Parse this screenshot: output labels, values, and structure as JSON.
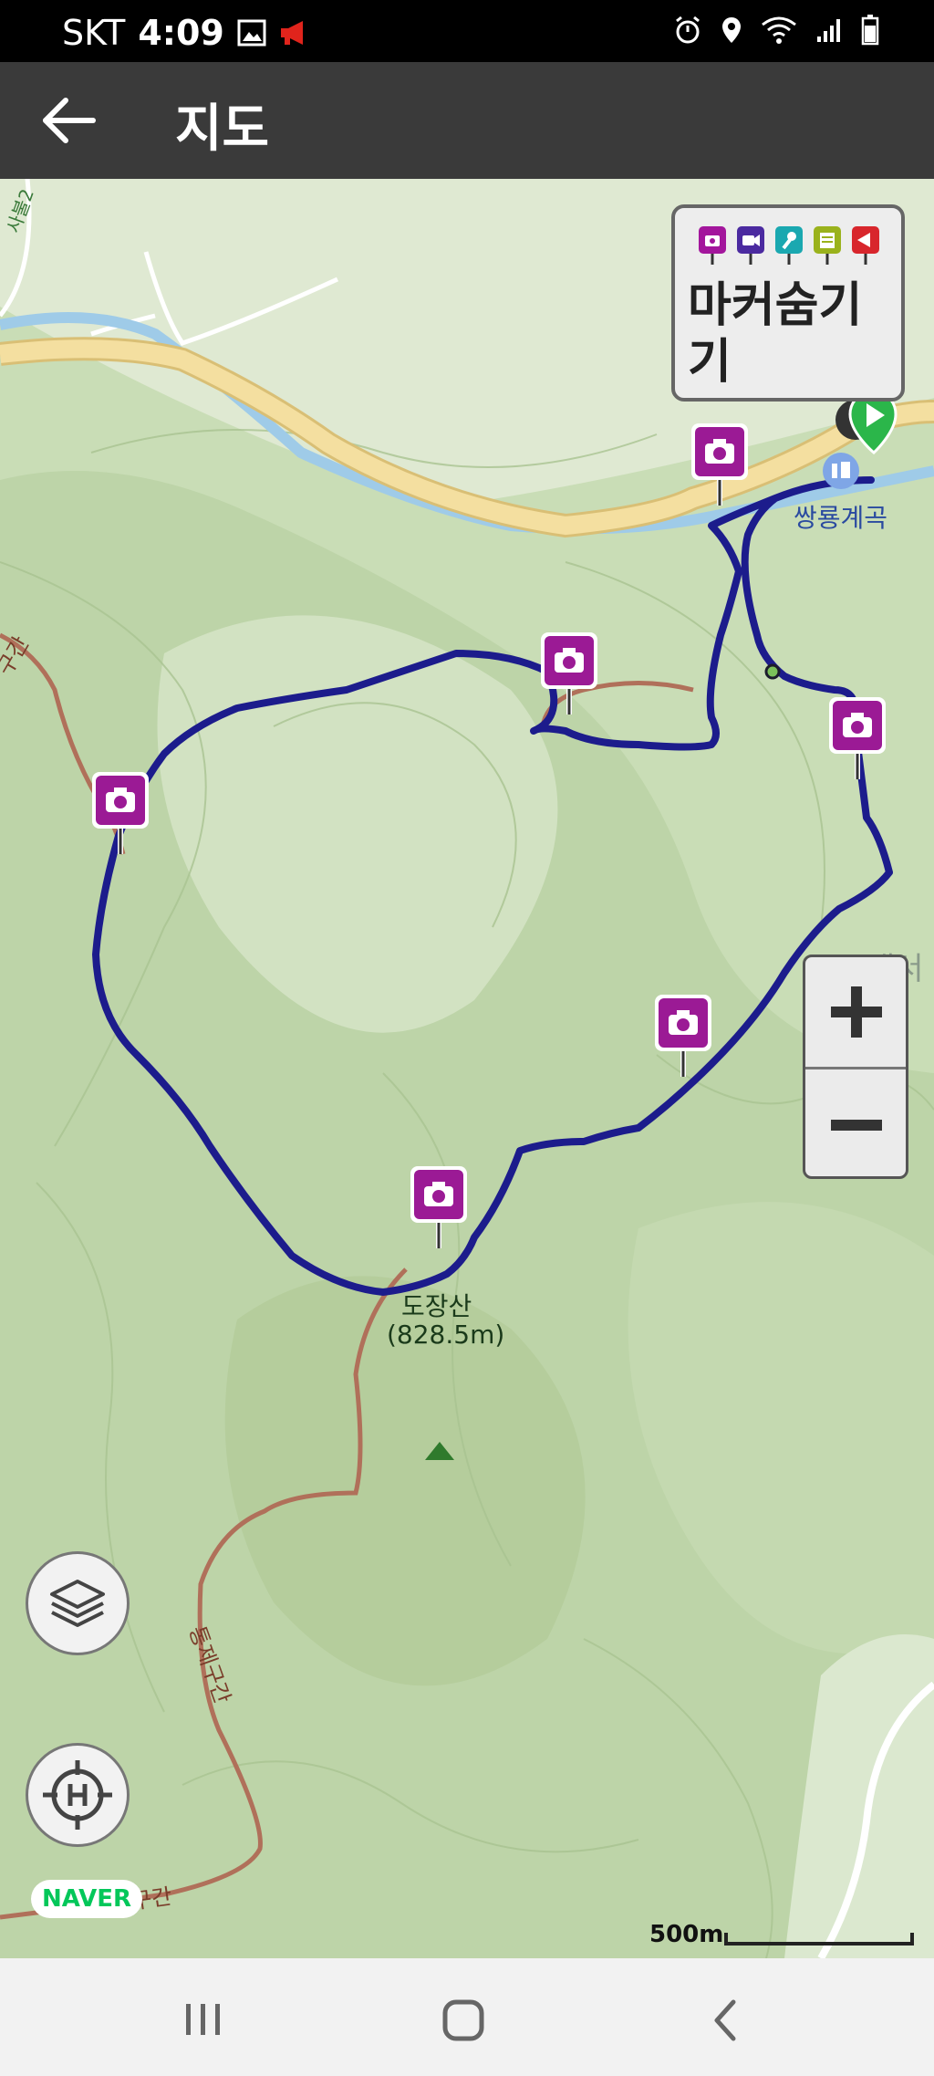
{
  "status_bar": {
    "carrier": "SKT",
    "time": "4:09"
  },
  "app_bar": {
    "title": "지도"
  },
  "marker_panel": {
    "label": "마커숨기기",
    "icon_colors": [
      "#a3169c",
      "#4b2aa0",
      "#1aa8b0",
      "#9ab21c",
      "#d8262c"
    ]
  },
  "map_labels": {
    "peak_name": "도장산",
    "peak_elevation": "(828.5m)",
    "valley_name": "쌍룡계곡",
    "place_right": "내서",
    "trail_left": "구간",
    "trail_lower": "통제구간",
    "trail_bottom": "통제구간",
    "trail_top": "사불2"
  },
  "naver_logo": "NAVER",
  "scale": {
    "label": "500m"
  },
  "colors": {
    "route": "#1c1c8c",
    "trail": "#b0705a",
    "marker": "#9b1a95",
    "road": "#f4dfa0",
    "river": "#9fcbe8"
  }
}
